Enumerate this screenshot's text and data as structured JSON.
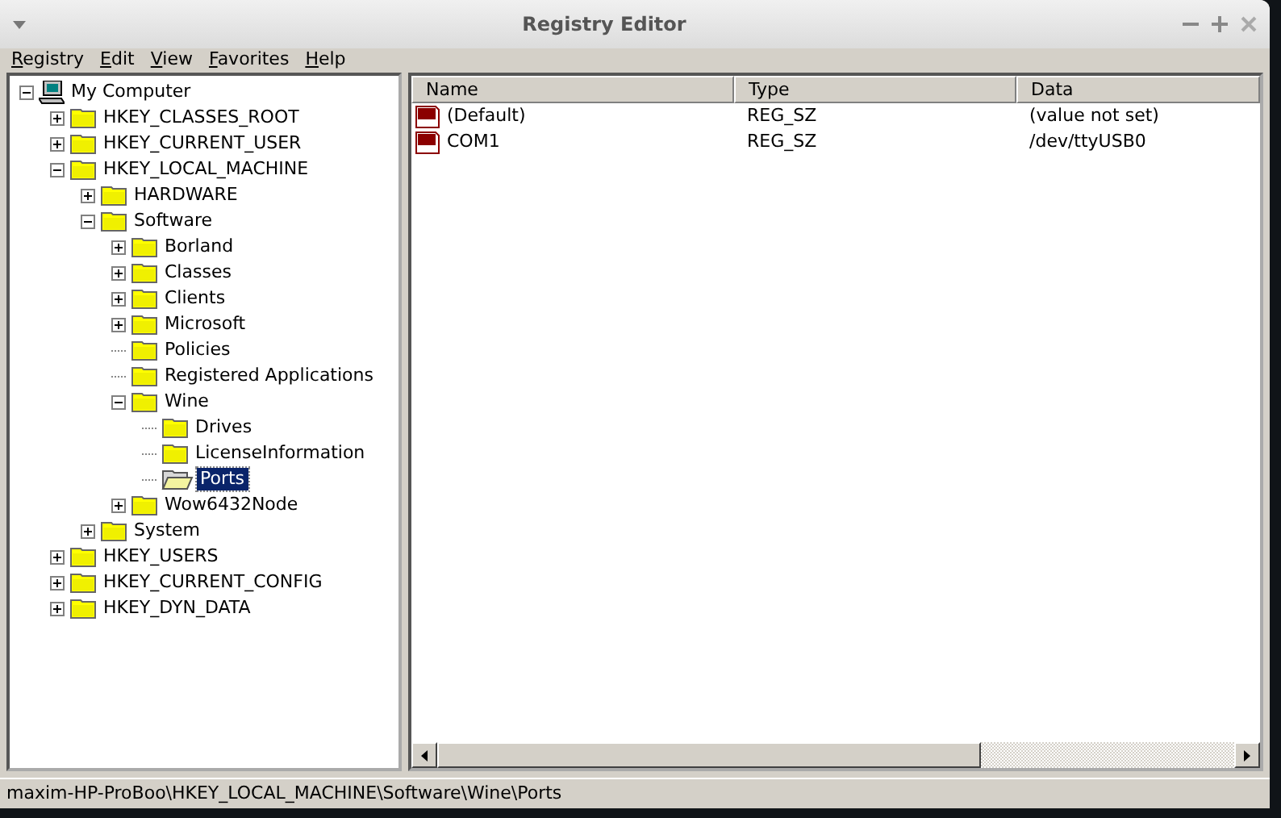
{
  "window": {
    "title": "Registry Editor"
  },
  "menu": [
    "Registry",
    "Edit",
    "View",
    "Favorites",
    "Help"
  ],
  "tree": [
    {
      "label": "My Computer",
      "kind": "computer",
      "expanded": true,
      "selected": false,
      "children": [
        {
          "label": "HKEY_CLASSES_ROOT",
          "kind": "folder",
          "expanded": false,
          "selected": false
        },
        {
          "label": "HKEY_CURRENT_USER",
          "kind": "folder",
          "expanded": false,
          "selected": false
        },
        {
          "label": "HKEY_LOCAL_MACHINE",
          "kind": "folder",
          "expanded": true,
          "selected": false,
          "children": [
            {
              "label": "HARDWARE",
              "kind": "folder",
              "expanded": false,
              "selected": false
            },
            {
              "label": "Software",
              "kind": "folder",
              "expanded": true,
              "selected": false,
              "children": [
                {
                  "label": "Borland",
                  "kind": "folder",
                  "expanded": false,
                  "selected": false
                },
                {
                  "label": "Classes",
                  "kind": "folder",
                  "expanded": false,
                  "selected": false
                },
                {
                  "label": "Clients",
                  "kind": "folder",
                  "expanded": false,
                  "selected": false
                },
                {
                  "label": "Microsoft",
                  "kind": "folder",
                  "expanded": false,
                  "selected": false
                },
                {
                  "label": "Policies",
                  "kind": "folder",
                  "selected": false
                },
                {
                  "label": "Registered Applications",
                  "kind": "folder",
                  "selected": false
                },
                {
                  "label": "Wine",
                  "kind": "folder",
                  "expanded": true,
                  "selected": false,
                  "children": [
                    {
                      "label": "Drives",
                      "kind": "folder",
                      "selected": false
                    },
                    {
                      "label": "LicenseInformation",
                      "kind": "folder",
                      "selected": false
                    },
                    {
                      "label": "Ports",
                      "kind": "folder",
                      "selected": true
                    }
                  ]
                },
                {
                  "label": "Wow6432Node",
                  "kind": "folder",
                  "expanded": false,
                  "selected": false
                }
              ]
            },
            {
              "label": "System",
              "kind": "folder",
              "expanded": false,
              "selected": false
            }
          ]
        },
        {
          "label": "HKEY_USERS",
          "kind": "folder",
          "expanded": false,
          "selected": false
        },
        {
          "label": "HKEY_CURRENT_CONFIG",
          "kind": "folder",
          "expanded": false,
          "selected": false
        },
        {
          "label": "HKEY_DYN_DATA",
          "kind": "folder",
          "expanded": false,
          "selected": false
        }
      ]
    }
  ],
  "list": {
    "columns": [
      "Name",
      "Type",
      "Data"
    ],
    "rows": [
      {
        "name": "(Default)",
        "type": "REG_SZ",
        "data": "(value not set)"
      },
      {
        "name": "COM1",
        "type": "REG_SZ",
        "data": "/dev/ttyUSB0"
      }
    ]
  },
  "status_bar": "maxim-HP-ProBoo\\HKEY_LOCAL_MACHINE\\Software\\Wine\\Ports"
}
